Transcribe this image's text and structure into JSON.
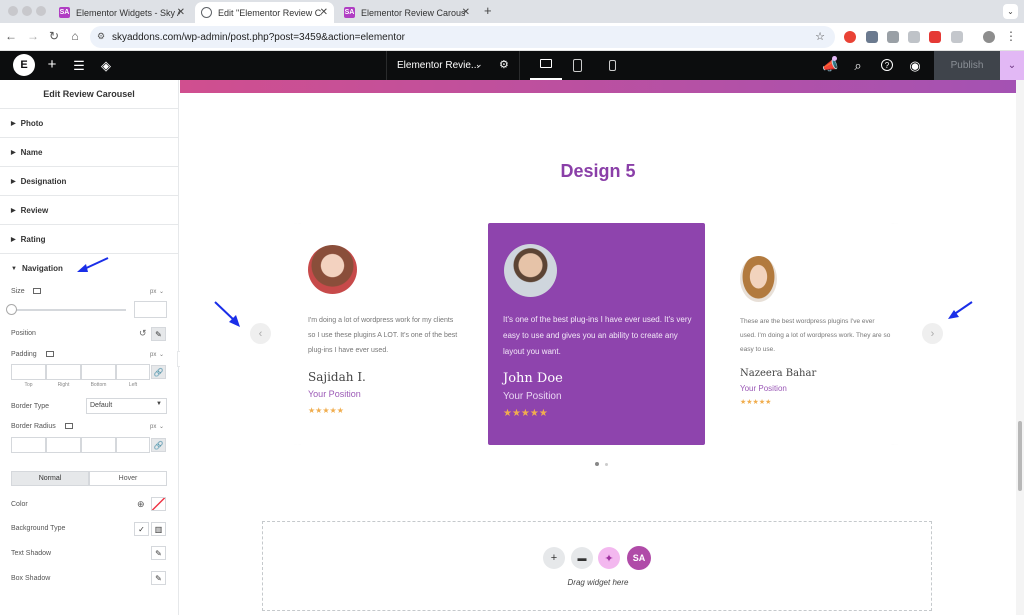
{
  "browser": {
    "tabs": [
      {
        "title": "Elementor Widgets - Sky Add",
        "favicon_color": "#b03dc3",
        "favicon_text": "SA"
      },
      {
        "title": "Edit \"Elementor Review Carous",
        "favicon_color": "#5f6368",
        "favicon_text": ""
      },
      {
        "title": "Elementor Review Carousel W",
        "favicon_color": "#b03dc3",
        "favicon_text": "SA"
      }
    ],
    "new_tab_symbol": "+",
    "url": "skyaddons.com/wp-admin/post.php?post=3459&action=elementor"
  },
  "topbar": {
    "logo": "E",
    "document_name": "Elementor Revie...",
    "publish_label": "Publish"
  },
  "panel": {
    "title": "Edit Review Carousel",
    "sections": [
      "Photo",
      "Name",
      "Designation",
      "Review",
      "Rating",
      "Navigation"
    ],
    "controls": {
      "size_label": "Size",
      "unit": "px",
      "position_label": "Position",
      "padding_label": "Padding",
      "sides": [
        "Top",
        "Right",
        "Bottom",
        "Left"
      ],
      "border_type_label": "Border Type",
      "border_type_value": "Default",
      "border_radius_label": "Border Radius",
      "tab_normal": "Normal",
      "tab_hover": "Hover",
      "color_label": "Color",
      "background_type_label": "Background Type",
      "text_shadow_label": "Text Shadow",
      "box_shadow_label": "Box Shadow"
    }
  },
  "canvas": {
    "design_title": "Design 5",
    "reviews": [
      {
        "text": "I'm doing a lot of wordpress work for my clients so I use these plugins A LOT. It's one of the best plug-ins I have ever used.",
        "name": "Sajidah I.",
        "position": "Your Position",
        "stars": "★★★★★"
      },
      {
        "text": "It's one of the best plug-ins I have ever used. It's very easy to use and gives you an ability to create any layout you want.",
        "name": "John Doe",
        "position": "Your Position",
        "stars": "★★★★★"
      },
      {
        "text": "These are the best wordpress plugins I've ever used. I'm doing a lot of wordpress work. They are so easy to use.",
        "name": "Nazeera Bahar",
        "position": "Your Position",
        "stars": "★★★★★"
      }
    ],
    "pagination": {
      "pages": 2,
      "active": 1
    },
    "drop_label": "Drag widget here"
  },
  "colors": {
    "accent_purple": "#8e44ad",
    "title_purple": "#8a3fa8",
    "star": "#f0ad4e",
    "annotation_arrow": "#1a2ee8"
  }
}
